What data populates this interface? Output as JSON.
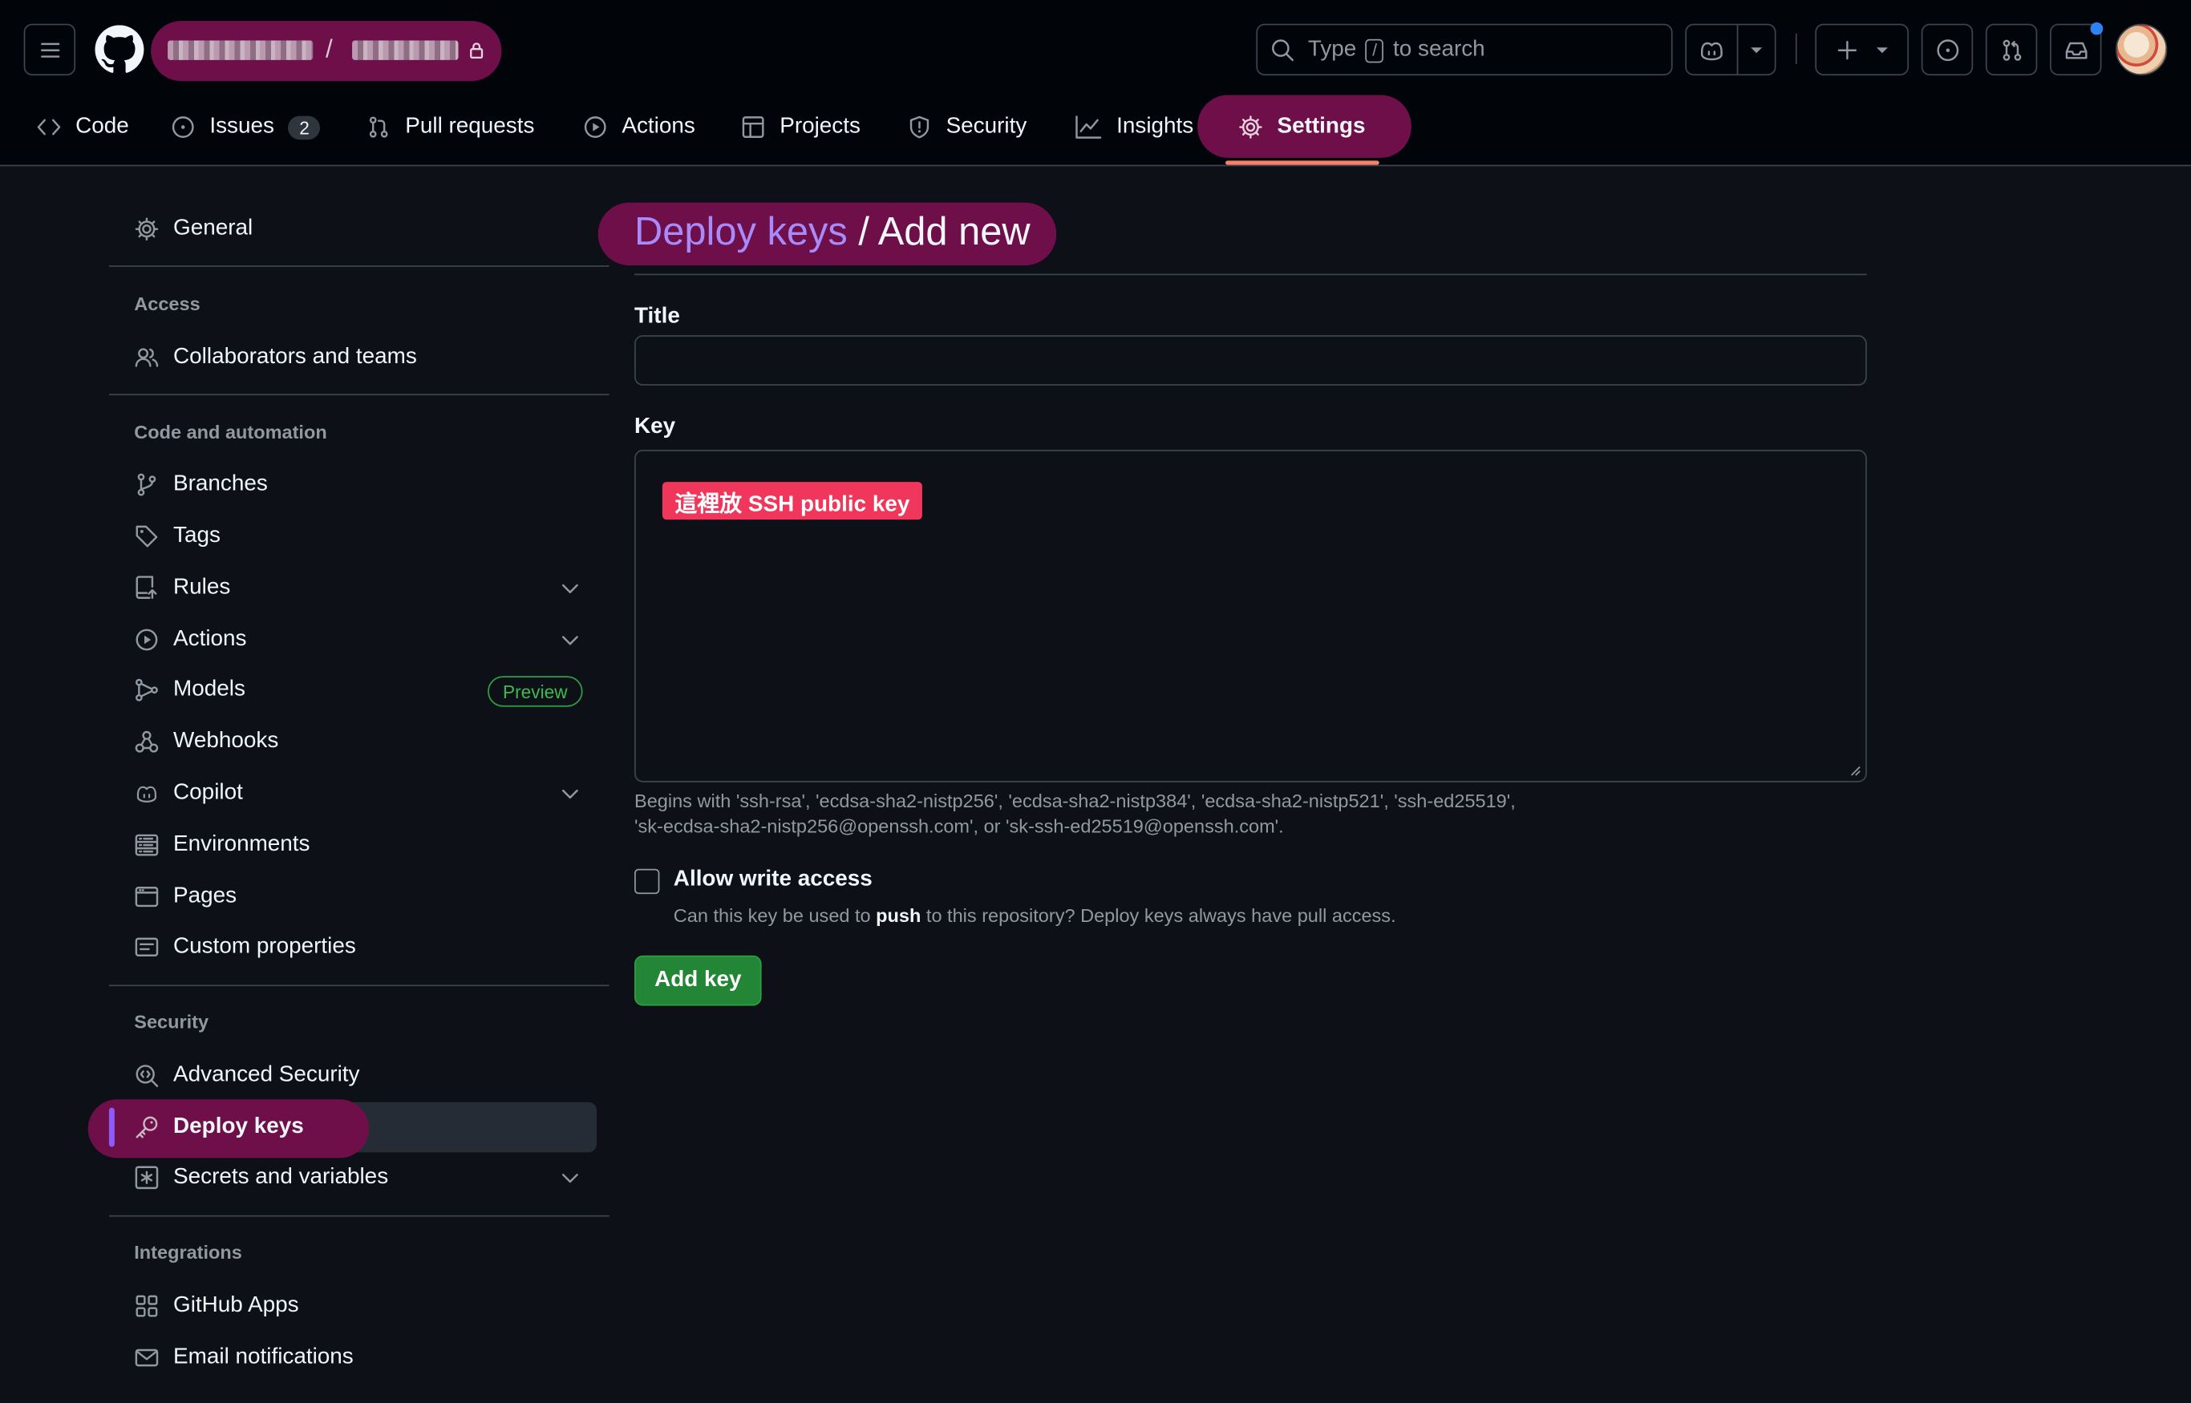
{
  "header": {
    "repo_separator": "/",
    "search_prefix": "Type",
    "search_key": "/",
    "search_suffix": "to search"
  },
  "tabs": [
    {
      "label": "Code"
    },
    {
      "label": "Issues",
      "count": "2"
    },
    {
      "label": "Pull requests"
    },
    {
      "label": "Actions"
    },
    {
      "label": "Projects"
    },
    {
      "label": "Security"
    },
    {
      "label": "Insights"
    },
    {
      "label": "Settings",
      "selected": true
    }
  ],
  "sidebar": {
    "general": "General",
    "access_heading": "Access",
    "collaborators": "Collaborators and teams",
    "code_heading": "Code and automation",
    "branches": "Branches",
    "tags": "Tags",
    "rules": "Rules",
    "actions": "Actions",
    "models": "Models",
    "models_badge": "Preview",
    "webhooks": "Webhooks",
    "copilot": "Copilot",
    "environments": "Environments",
    "pages": "Pages",
    "custom_properties": "Custom properties",
    "security_heading": "Security",
    "advanced_security": "Advanced Security",
    "deploy_keys": "Deploy keys",
    "secrets": "Secrets and variables",
    "integrations_heading": "Integrations",
    "github_apps": "GitHub Apps",
    "email_notifications": "Email notifications"
  },
  "main": {
    "breadcrumb_link": "Deploy keys",
    "breadcrumb_rest": " / Add new",
    "title_label": "Title",
    "title_value": "",
    "key_label": "Key",
    "key_annotation": "這裡放 SSH public key",
    "key_help_line1": "Begins with 'ssh-rsa', 'ecdsa-sha2-nistp256', 'ecdsa-sha2-nistp384', 'ecdsa-sha2-nistp521', 'ssh-ed25519',",
    "key_help_line2": "'sk-ecdsa-sha2-nistp256@openssh.com', or 'sk-ssh-ed25519@openssh.com'.",
    "allow_write_label": "Allow write access",
    "allow_write_checked": false,
    "allow_write_help_pre": "Can this key be used to ",
    "allow_write_help_bold": "push",
    "allow_write_help_post": " to this repository? Deploy keys always have pull access.",
    "add_button": "Add key"
  },
  "colors": {
    "highlight": "#6f0f4a",
    "annotation": "#f0365a",
    "primary_button": "#238636",
    "link": "#a78bfa"
  }
}
